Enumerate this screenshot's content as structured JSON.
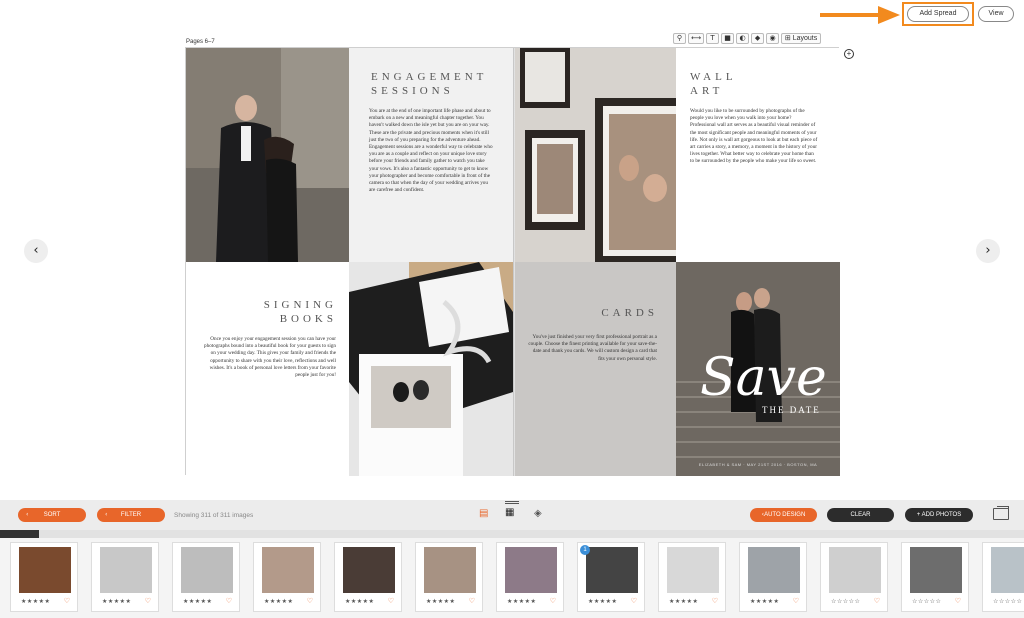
{
  "header": {
    "add_spread_label": "Add Spread",
    "view_label": "View",
    "accent": "#f28a1e"
  },
  "spread": {
    "pages_label": "Pages 6–7",
    "toolbar": {
      "icons": [
        "zoom-icon",
        "fit-width-icon",
        "text-icon",
        "square-icon",
        "half-circle-icon",
        "pin-icon",
        "eye-icon"
      ],
      "glyphs": [
        "⚲",
        "⟷",
        "T",
        "■",
        "◐",
        "◆",
        "◉"
      ],
      "layouts_label": "Layouts",
      "layouts_glyph": "⊞"
    },
    "engagement": {
      "title_line1": "ENGAGEMENT",
      "title_line2": "SESSIONS",
      "body": "You are at the end of one important life phase and about to embark on a new and meaningful chapter together. You haven't walked down the isle yet but you are on your way. These are the private and precious moments when it's still just the two of you preparing for the adventure ahead. Engagement sessions are a wonderful way to celebrate who you are as a couple and reflect on your unique love story before your friends and family gather to watch you take your vows. It's also a fantastic opportunity to get to know your photographer and become comfortable in front of the camera so that when the day of your wedding arrives you are carefree and confident."
    },
    "wall_art": {
      "title_line1": "WALL",
      "title_line2": "ART",
      "body": "Would you like to be surrounded by photographs of the people you love when you walk into your home? Professional wall art serves as a beautiful visual reminder of the most significant people and meaningful moments of your life. Not only is wall art gorgeous to look at but each piece of art carries a story, a memory, a moment in the history of your lives together. What better way to celebrate your home than to be surrounded by the people who make your life so sweet."
    },
    "signing": {
      "title_line1": "SIGNING",
      "title_line2": "BOOKS",
      "body": "Once you enjoy your engagement session you can have your photographs bound into a beautiful book for your guests to sign on your wedding day. This gives your family and friends the opportunity to share with you their love, reflections and well wishes. It's a book of personal love letters from your favorite people just for you!"
    },
    "cards": {
      "title": "CARDS",
      "body": "You've just finished your very first professional portrait as a couple. Choose the finest printing available for your save-the-date and thank you cards. We will custom design a card that fits your own personal style."
    },
    "save_the_date": {
      "script": "Save",
      "sub": "THE DATE",
      "footer": "ELIZABETH & SAM · MAY 21ST 2016 · BOSTON, MA"
    }
  },
  "bottom_bar": {
    "sort_label": "SORT",
    "filter_label": "FILTER",
    "showing_text": "Showing 311 of 311 images",
    "auto_design_label": "AUTO DESIGN",
    "clear_label": "CLEAR",
    "add_photos_label": "+ ADD PHOTOS",
    "orange": "#e8662a"
  },
  "thumbnails": [
    {
      "stars": "★★★★★",
      "color": "#7a4a2e",
      "badge": ""
    },
    {
      "stars": "★★★★★",
      "color": "#c8c8c8",
      "badge": ""
    },
    {
      "stars": "★★★★★",
      "color": "#bdbdbd",
      "badge": ""
    },
    {
      "stars": "★★★★★",
      "color": "#b39a8a",
      "badge": ""
    },
    {
      "stars": "★★★★★",
      "color": "#4a3c36",
      "badge": ""
    },
    {
      "stars": "★★★★★",
      "color": "#a79283",
      "badge": ""
    },
    {
      "stars": "★★★★★",
      "color": "#8d7a88",
      "badge": ""
    },
    {
      "stars": "★★★★★",
      "color": "#444444",
      "badge": "1"
    },
    {
      "stars": "★★★★★",
      "color": "#d8d8d8",
      "badge": ""
    },
    {
      "stars": "★★★★★",
      "color": "#9ea3a8",
      "badge": ""
    },
    {
      "stars": "☆☆☆☆☆",
      "color": "#cfcfcf",
      "badge": ""
    },
    {
      "stars": "☆☆☆☆☆",
      "color": "#6d6d6d",
      "badge": ""
    },
    {
      "stars": "☆☆☆☆☆",
      "color": "#b9c2c8",
      "badge": ""
    }
  ],
  "scroll": {
    "progress_fraction": 0.038
  }
}
